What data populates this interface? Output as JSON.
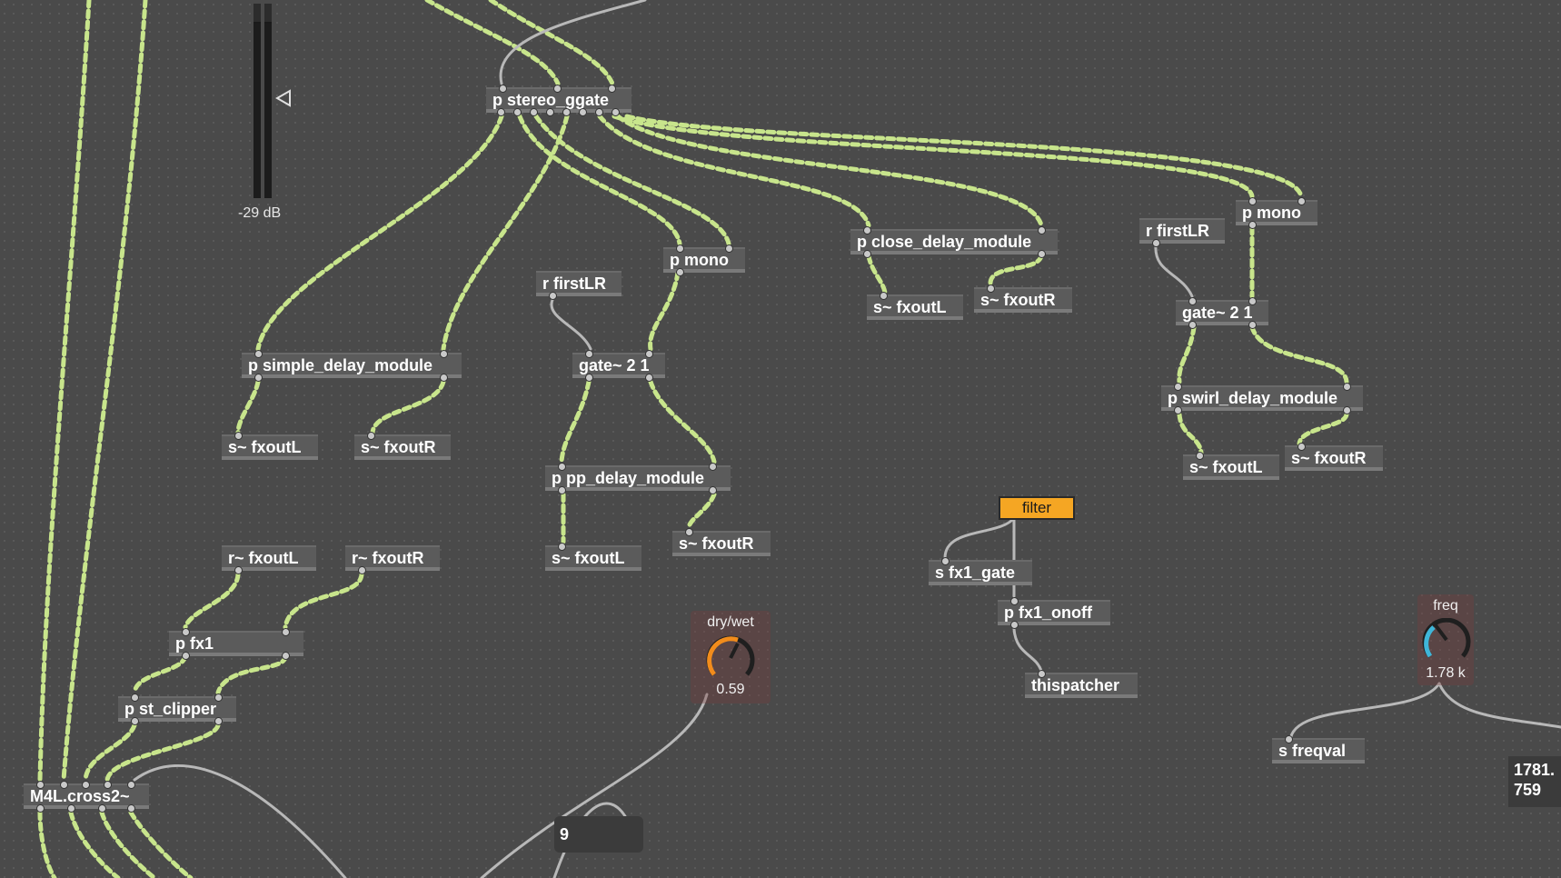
{
  "patch": {
    "objects": {
      "stereo_ggate": "p stereo_ggate",
      "simple_delay": "p simple_delay_module",
      "s_fxoutL_1": "s~ fxoutL",
      "s_fxoutR_1": "s~ fxoutR",
      "r_firstLR_1": "r firstLR",
      "p_mono_1": "p mono",
      "gate_1": "gate~ 2 1",
      "pp_delay": "p pp_delay_module",
      "s_fxoutL_2": "s~ fxoutL",
      "s_fxoutR_2": "s~ fxoutR",
      "close_delay": "p close_delay_module",
      "s_fxoutL_3": "s~ fxoutL",
      "s_fxoutR_3": "s~ fxoutR",
      "r_firstLR_2": "r firstLR",
      "p_mono_2": "p mono",
      "gate_2": "gate~ 2 1",
      "swirl_delay": "p swirl_delay_module",
      "s_fxoutL_4": "s~ fxoutL",
      "s_fxoutR_4": "s~ fxoutR",
      "r_fxoutL": "r~ fxoutL",
      "r_fxoutR": "r~ fxoutR",
      "p_fx1": "p fx1",
      "st_clipper": "p st_clipper",
      "cross2": "M4L.cross2~",
      "s_fx1_gate": "s fx1_gate",
      "p_fx1_onoff": "p fx1_onoff",
      "thispatcher": "thispatcher",
      "s_freqval": "s freqval"
    },
    "meter": {
      "db_label": "-29 dB"
    },
    "filter_toggle": {
      "label": "filter",
      "color": "#f5a623"
    },
    "drywet_dial": {
      "title": "dry/wet",
      "value": "0.59",
      "color": "#f28c1c"
    },
    "freq_dial": {
      "title": "freq",
      "value": "1.78 k",
      "color": "#3fb6d9"
    },
    "number_box": {
      "value": "9"
    },
    "readout": {
      "line1": "1781.",
      "line2": "759"
    },
    "colors": {
      "signal_cord": "#c8e58c",
      "control_cord": "#b8b8b8",
      "background": "#4a4a4a"
    }
  }
}
